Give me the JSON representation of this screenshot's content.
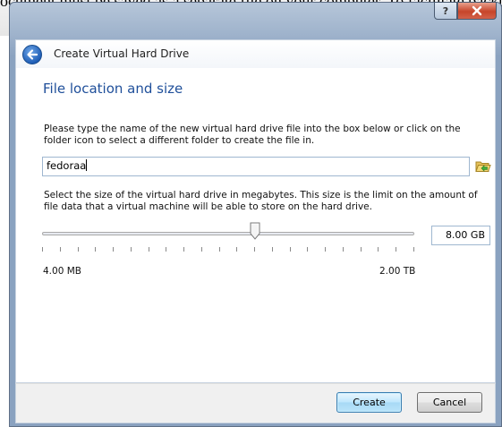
{
  "window": {
    "title": "Create Virtual Hard Drive",
    "help_label": "?",
    "background_doc_text": "ocument must be saved as a separate file on your computer. To facilitate backup of the lectures, please"
  },
  "page": {
    "title": "File location and size",
    "location_description": "Please type the name of the new virtual hard drive file into the box below or click on the folder icon to select a different folder to create the file in.",
    "file_name": "fedoraa",
    "size_description": "Select the size of the virtual hard drive in megabytes. This size is the limit on the amount of file data that a virtual machine will be able to store on the hard drive.",
    "slider": {
      "min_label": "4.00 MB",
      "max_label": "2.00 TB",
      "position_fraction": 0.573
    },
    "size_value": "8.00 GB"
  },
  "buttons": {
    "create": "Create",
    "cancel": "Cancel"
  },
  "colors": {
    "title_blue": "#1f4f9a",
    "default_button_border": "#3c7fb1"
  },
  "icons": [
    "help-icon",
    "close-icon",
    "back-arrow-icon",
    "folder-icon",
    "slider-thumb-icon"
  ]
}
